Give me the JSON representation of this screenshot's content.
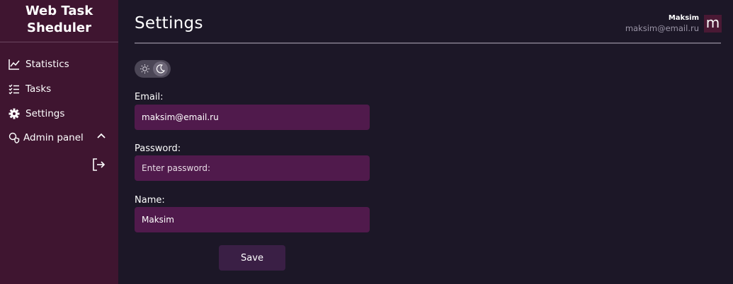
{
  "brand": {
    "line1": "Web Task",
    "line2": "Sheduler"
  },
  "sidebar": {
    "items": [
      {
        "label": "Statistics",
        "icon": "chart-line-icon"
      },
      {
        "label": "Tasks",
        "icon": "checklist-icon"
      },
      {
        "label": "Settings",
        "icon": "gear-icon"
      },
      {
        "label": "Admin panel",
        "icon": "user-shield-icon"
      }
    ],
    "expand_icon": "chevron-up-icon",
    "logout_icon": "logout-icon"
  },
  "header": {
    "title": "Settings",
    "user_name": "Maksim",
    "user_email": "maksim@email.ru",
    "avatar_letter": "m"
  },
  "theme_toggle": {
    "light_icon": "sun-icon",
    "dark_icon": "moon-icon",
    "selected": "dark"
  },
  "form": {
    "email": {
      "label": "Email:",
      "value": "maksim@email.ru"
    },
    "password": {
      "label": "Password:",
      "placeholder": "Enter password:"
    },
    "name": {
      "label": "Name:",
      "value": "Maksim"
    },
    "save_label": "Save"
  },
  "colors": {
    "background": "#1c1727",
    "sidebar": "#3f1530",
    "field": "#501a4c",
    "button": "#3a1f45",
    "avatar": "#4a1934"
  }
}
